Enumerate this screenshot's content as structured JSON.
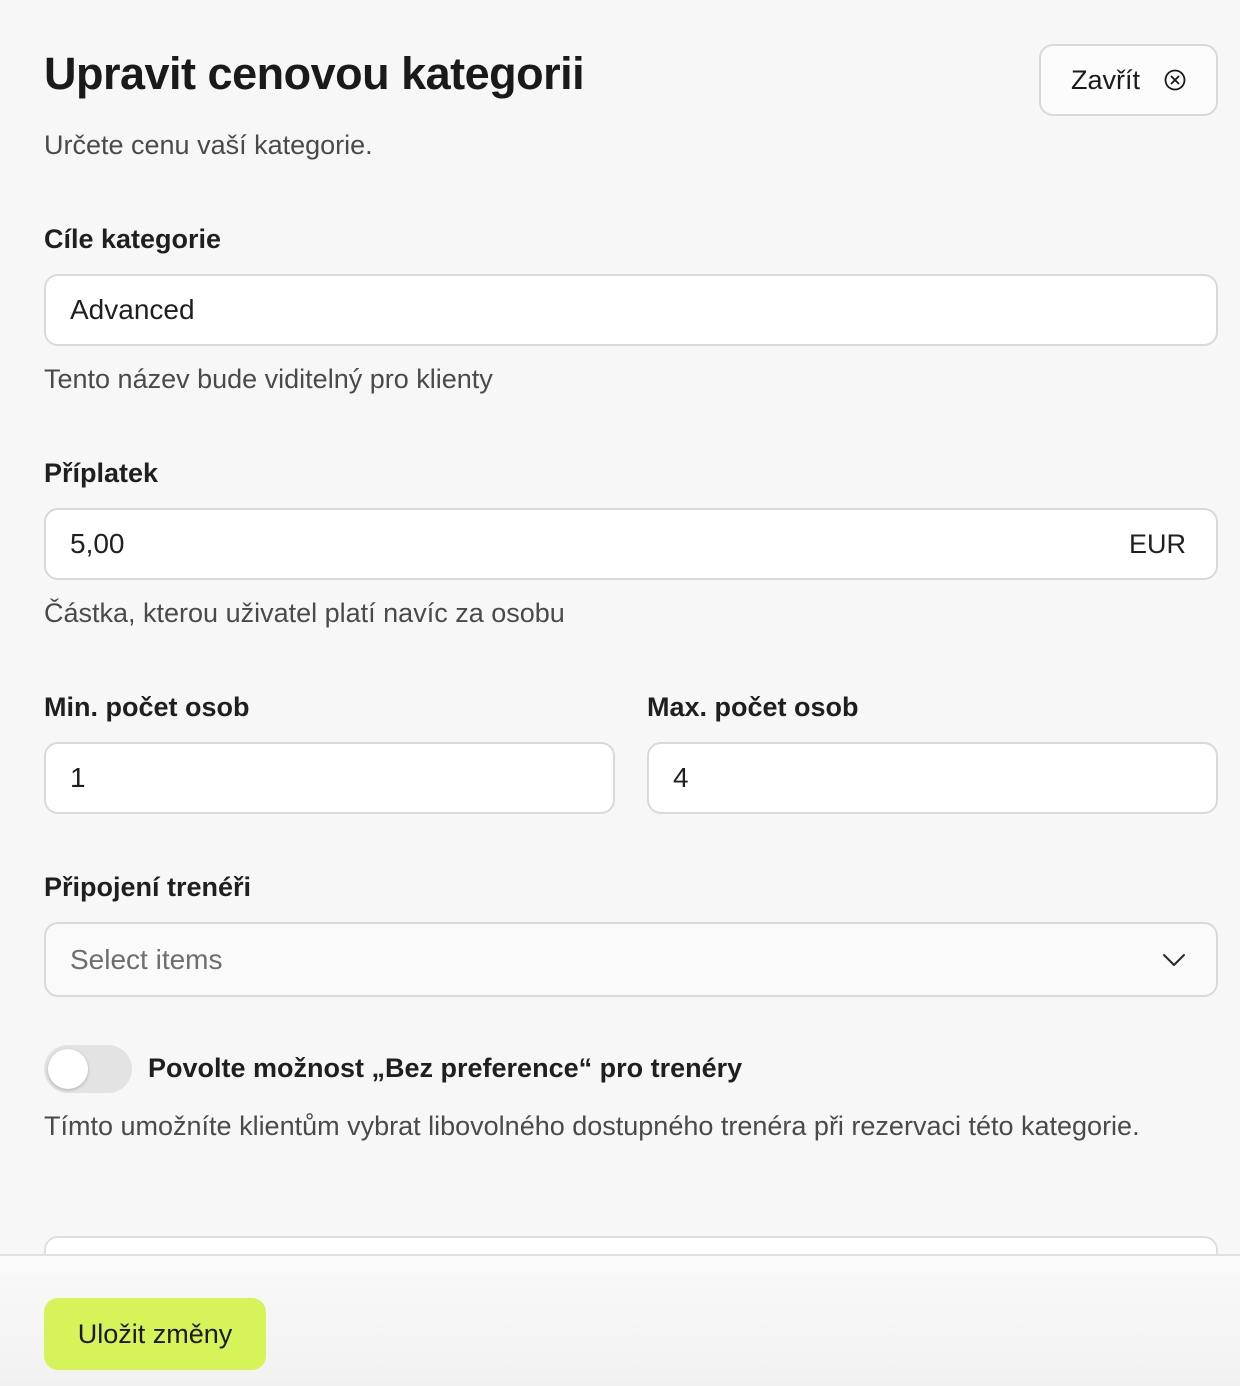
{
  "header": {
    "title": "Upravit cenovou kategorii",
    "subtitle": "Určete cenu vaší kategorie.",
    "close_label": "Zavřít"
  },
  "form": {
    "name": {
      "label": "Cíle kategorie",
      "value": "Advanced",
      "help": "Tento název bude viditelný pro klienty"
    },
    "surcharge": {
      "label": "Příplatek",
      "value": "5,00",
      "currency": "EUR",
      "help": "Částka, kterou uživatel platí navíc za osobu"
    },
    "min_persons": {
      "label": "Min. počet osob",
      "value": "1"
    },
    "max_persons": {
      "label": "Max. počet osob",
      "value": "4"
    },
    "trainers": {
      "label": "Připojení trenéři",
      "placeholder": "Select items"
    },
    "no_preference": {
      "label": "Povolte možnost „Bez preference“ pro trenéry",
      "enabled": false,
      "help": "Tímto umožníte klientům vybrat libovolného dostupného trenéra při rezervaci této kategorie."
    }
  },
  "footer": {
    "save_label": "Uložit změny"
  },
  "colors": {
    "accent": "#d6f35a",
    "background": "#f7f7f7",
    "border": "#d9d9d9"
  },
  "icons": {
    "close": "circle-x-icon",
    "dropdown": "chevron-down-icon"
  }
}
